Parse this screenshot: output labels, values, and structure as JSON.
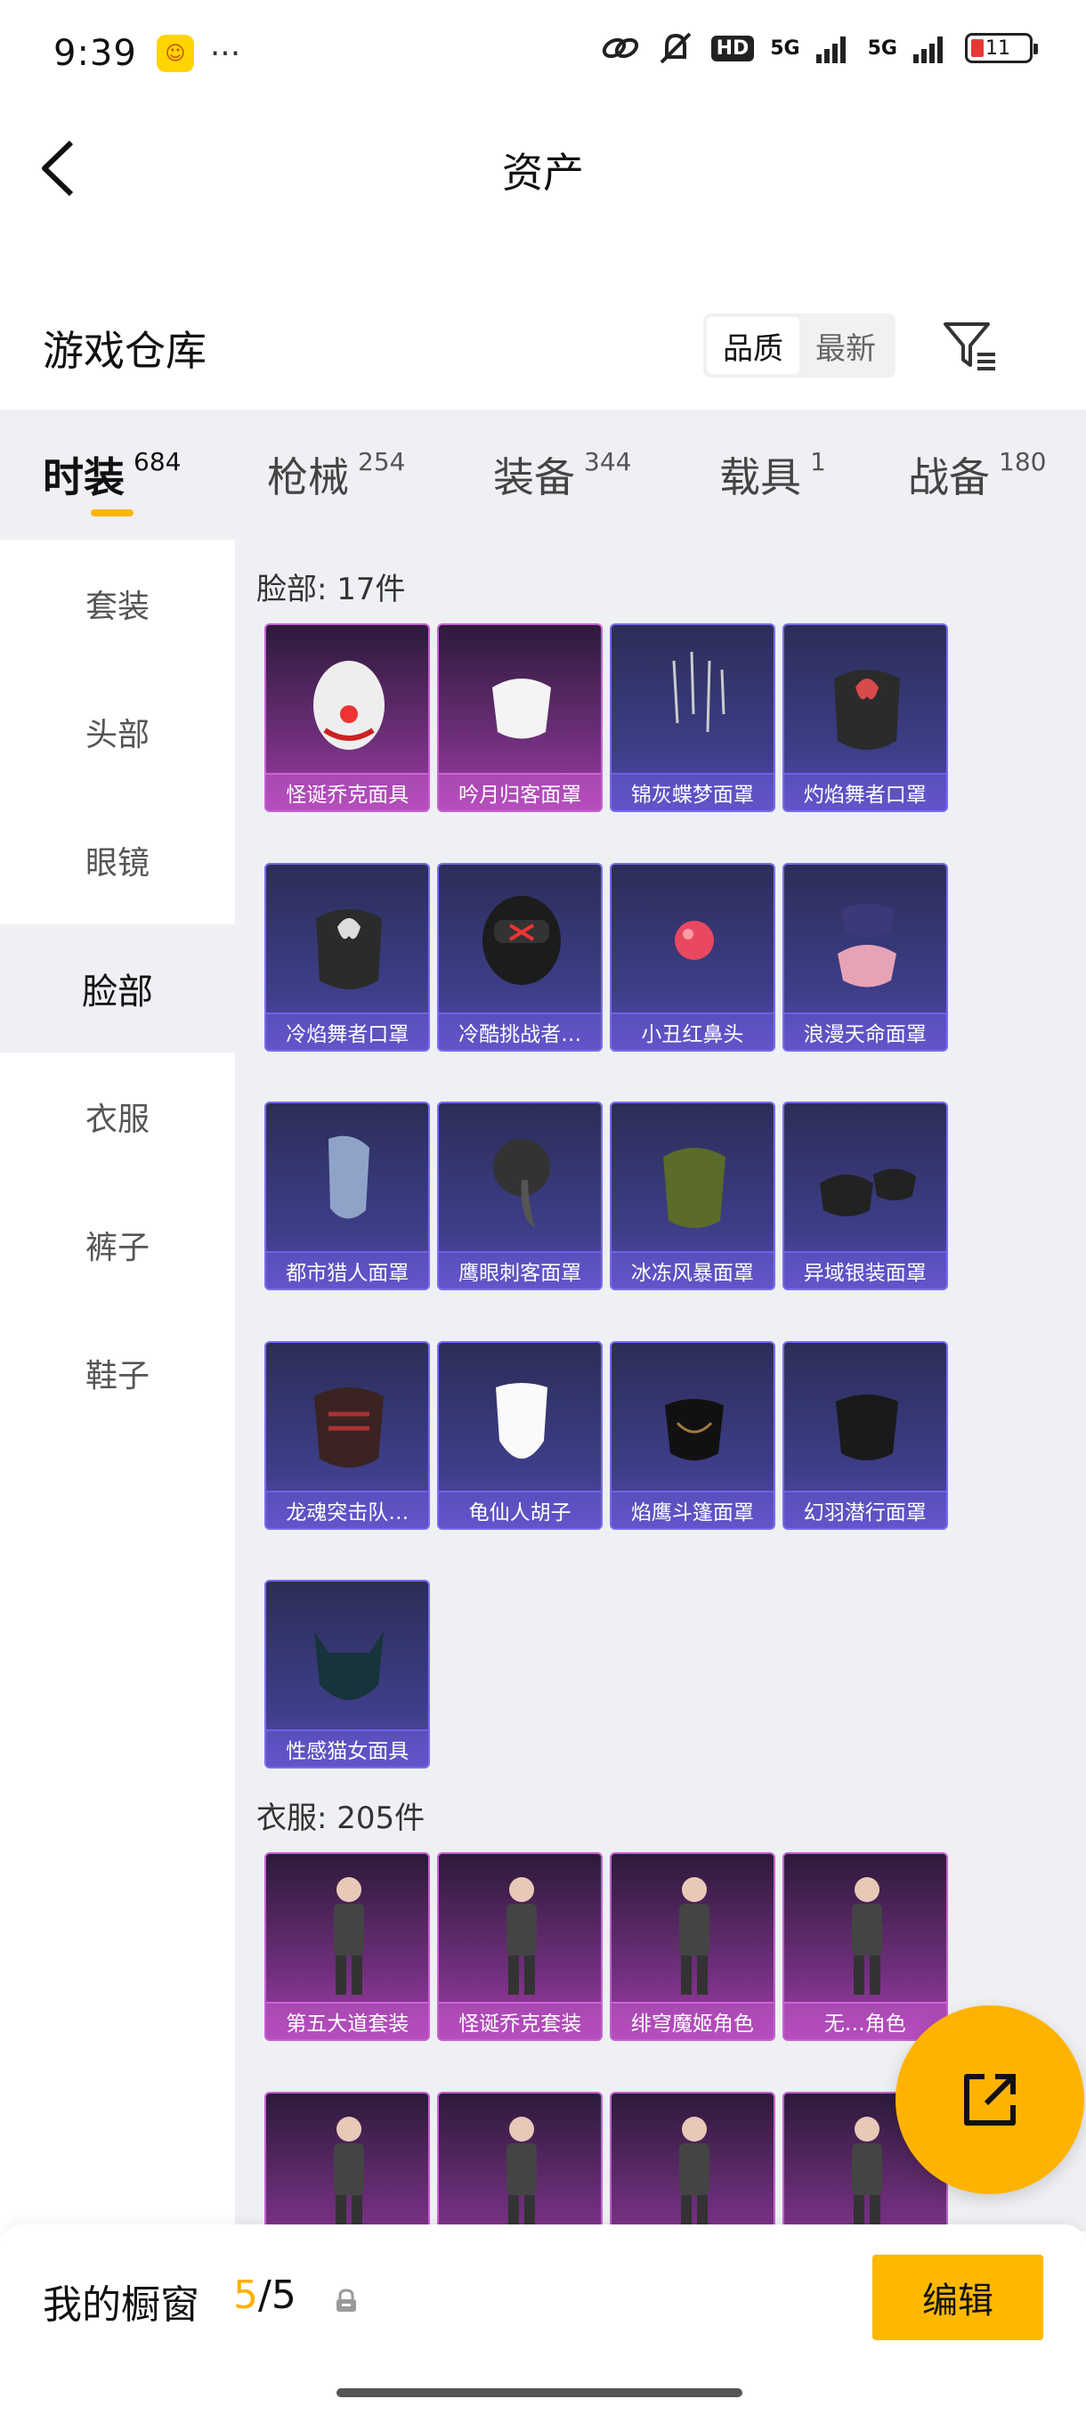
{
  "status_bar": {
    "time": "9:39",
    "dots": "···",
    "hd_label": "HD",
    "net1": "5G",
    "net2": "5G",
    "battery": "11"
  },
  "nav": {
    "title": "资产",
    "back_icon": "chevron-left-icon"
  },
  "warehouse": {
    "title": "游戏仓库",
    "sort_options": [
      "品质",
      "最新"
    ],
    "active_sort": "品质",
    "filter_icon": "filter-icon"
  },
  "categories": [
    {
      "label": "时装",
      "count": "684"
    },
    {
      "label": "枪械",
      "count": "254"
    },
    {
      "label": "装备",
      "count": "344"
    },
    {
      "label": "载具",
      "count": "1"
    },
    {
      "label": "战备",
      "count": "180"
    }
  ],
  "sidebar": {
    "items": [
      "套装",
      "头部",
      "眼镜",
      "脸部",
      "衣服",
      "裤子",
      "鞋子"
    ],
    "active": "脸部"
  },
  "sections": [
    {
      "title": "脸部: 17件",
      "items": [
        {
          "name": "怪诞乔克面具",
          "tier": "purple"
        },
        {
          "name": "吟月归客面罩",
          "tier": "purple"
        },
        {
          "name": "锦灰蝶梦面罩",
          "tier": "blue"
        },
        {
          "name": "灼焰舞者口罩",
          "tier": "blue"
        },
        {
          "name": "冷焰舞者口罩",
          "tier": "blue"
        },
        {
          "name": "冷酷挑战者…",
          "tier": "blue"
        },
        {
          "name": "小丑红鼻头",
          "tier": "blue"
        },
        {
          "name": "浪漫天命面罩",
          "tier": "blue"
        },
        {
          "name": "都市猎人面罩",
          "tier": "blue"
        },
        {
          "name": "鹰眼刺客面罩",
          "tier": "blue"
        },
        {
          "name": "冰冻风暴面罩",
          "tier": "blue"
        },
        {
          "name": "异域银装面罩",
          "tier": "blue"
        },
        {
          "name": "龙魂突击队…",
          "tier": "blue"
        },
        {
          "name": "龟仙人胡子",
          "tier": "blue"
        },
        {
          "name": "焰鹰斗篷面罩",
          "tier": "blue"
        },
        {
          "name": "幻羽潜行面罩",
          "tier": "blue"
        },
        {
          "name": "性感猫女面具",
          "tier": "blue"
        }
      ]
    },
    {
      "title": "衣服: 205件",
      "items": [
        {
          "name": "第五大道套装",
          "tier": "purple"
        },
        {
          "name": "怪诞乔克套装",
          "tier": "purple"
        },
        {
          "name": "绯穹魔姬角色",
          "tier": "purple"
        },
        {
          "name": "无…角色",
          "tier": "purple"
        },
        {
          "name": "",
          "tier": "purple"
        },
        {
          "name": "",
          "tier": "purple"
        },
        {
          "name": "",
          "tier": "purple"
        },
        {
          "name": "",
          "tier": "purple"
        }
      ]
    }
  ],
  "fab": {
    "icon": "share-external-icon"
  },
  "bottom_bar": {
    "label": "我的橱窗",
    "current": "5",
    "total": "/5",
    "lock_icon": "lock-icon",
    "edit_label": "编辑"
  }
}
